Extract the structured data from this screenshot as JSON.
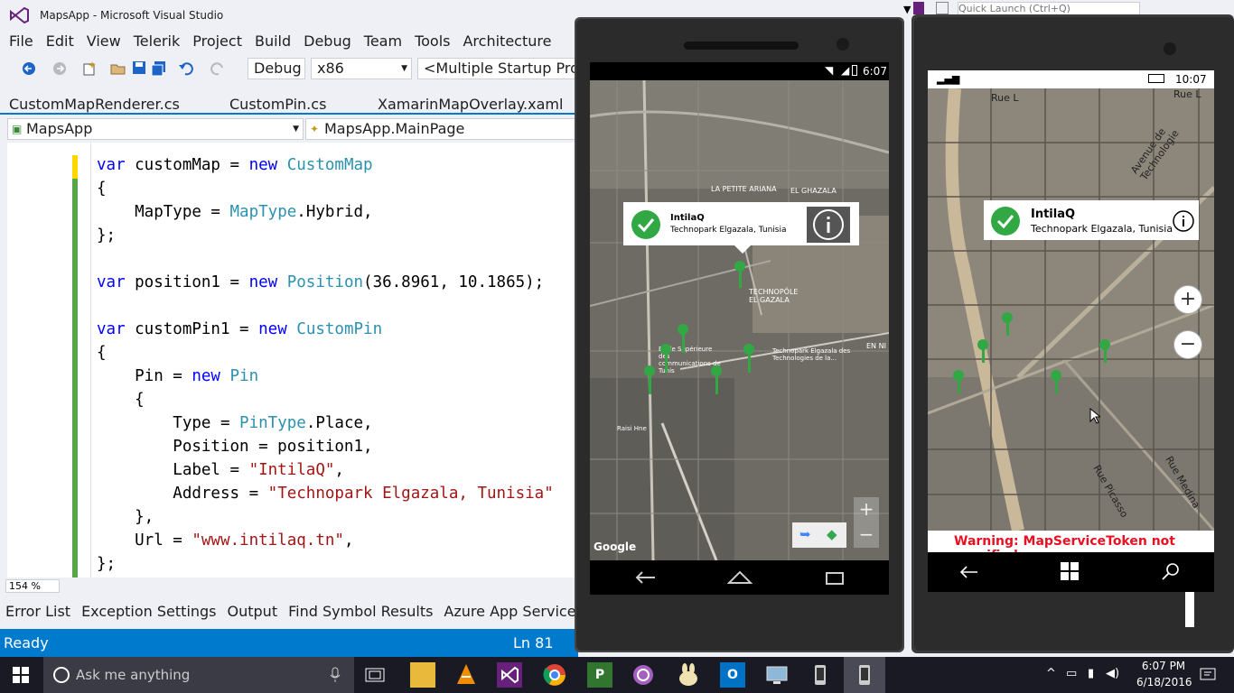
{
  "vs": {
    "title": "MapsApp - Microsoft Visual Studio",
    "menu": [
      "File",
      "Edit",
      "View",
      "Telerik",
      "Project",
      "Build",
      "Debug",
      "Team",
      "Tools",
      "Architecture"
    ],
    "toolbar": {
      "config": "Debug",
      "platform": "x86",
      "startup": "<Multiple Startup Projects>"
    },
    "tabs": [
      "CustomMapRenderer.cs",
      "CustomPin.cs",
      "XamarinMapOverlay.xaml"
    ],
    "nav": {
      "project": "MapsApp",
      "member": "MapsApp.MainPage"
    },
    "code": [
      "var customMap = new CustomMap",
      "{",
      "    MapType = MapType.Hybrid,",
      "};",
      "",
      "var position1 = new Position(36.8961, 10.1865);",
      "",
      "var customPin1 = new CustomPin",
      "{",
      "    Pin = new Pin",
      "    {",
      "        Type = PinType.Place,",
      "        Position = position1,",
      "        Label = \"IntilaQ\",",
      "        Address = \"Technopark Elgazala, Tunisia\"",
      "    },",
      "    Url = \"www.intilaq.tn\",",
      "};"
    ],
    "zoom": "154 %",
    "bottom_tabs": [
      "Error List",
      "Exception Settings",
      "Output",
      "Find Symbol Results",
      "Azure App Service Activity"
    ],
    "status": {
      "left": "Ready",
      "line": "Ln 81"
    },
    "quick_launch_placeholder": "Quick Launch (Ctrl+Q)"
  },
  "android": {
    "time": "6:07",
    "callout": {
      "title": "IntilaQ",
      "address": "Technopark Elgazala, Tunisia"
    },
    "map_labels": [
      "LA PETITE ARIANA",
      "EL GHAZALA",
      "TECHNOPÔLE EL GAZALA",
      "Ecole Supérieure des communications de Tunis",
      "Technopark Elgazala des Technologies de la...",
      "EN NI",
      "Raisi Hne"
    ],
    "google_label": "Google",
    "zoom_in": "+",
    "zoom_out": "−"
  },
  "winphone": {
    "time": "10:07",
    "callout": {
      "title": "IntilaQ",
      "address": "Technopark Elgazala, Tunisia"
    },
    "map_labels": [
      "Rue L",
      "Avenue de Technologie",
      "Rue Picasso",
      "Rue Medina",
      "Rue L"
    ],
    "warning": "Warning: MapServiceToken not specified.",
    "zoom_in": "+",
    "zoom_out": "−"
  },
  "taskbar": {
    "search_placeholder": "Ask me anything",
    "time": "6:07 PM",
    "date": "6/18/2016"
  },
  "colors": {
    "vs_blue": "#007acc",
    "pin_green": "#32a845",
    "warning_red": "#e81123"
  }
}
